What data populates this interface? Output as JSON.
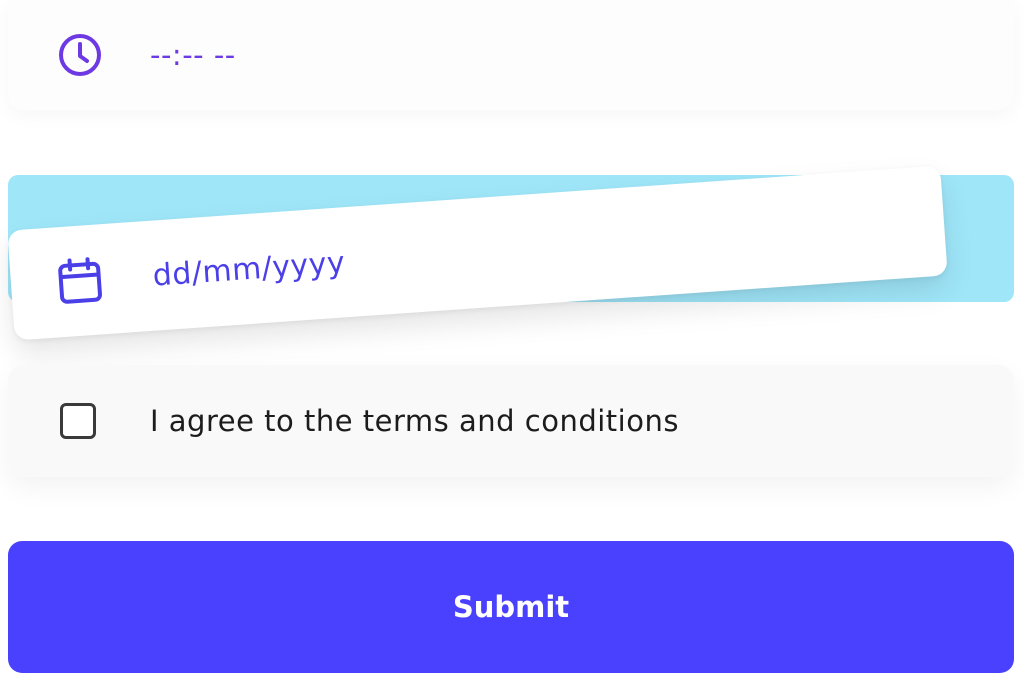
{
  "time_field": {
    "icon": "clock-icon",
    "placeholder": "--:-- --"
  },
  "date_field": {
    "icon": "calendar-icon",
    "placeholder": "dd/mm/yyyy"
  },
  "agree_field": {
    "checked": false,
    "label": "I agree to the terms and conditions"
  },
  "submit": {
    "label": "Submit"
  },
  "colors": {
    "accent": "#4941fe",
    "time_icon": "#6d39e2",
    "date_text": "#4b3fe8",
    "backdrop": "#9fe6f9"
  }
}
